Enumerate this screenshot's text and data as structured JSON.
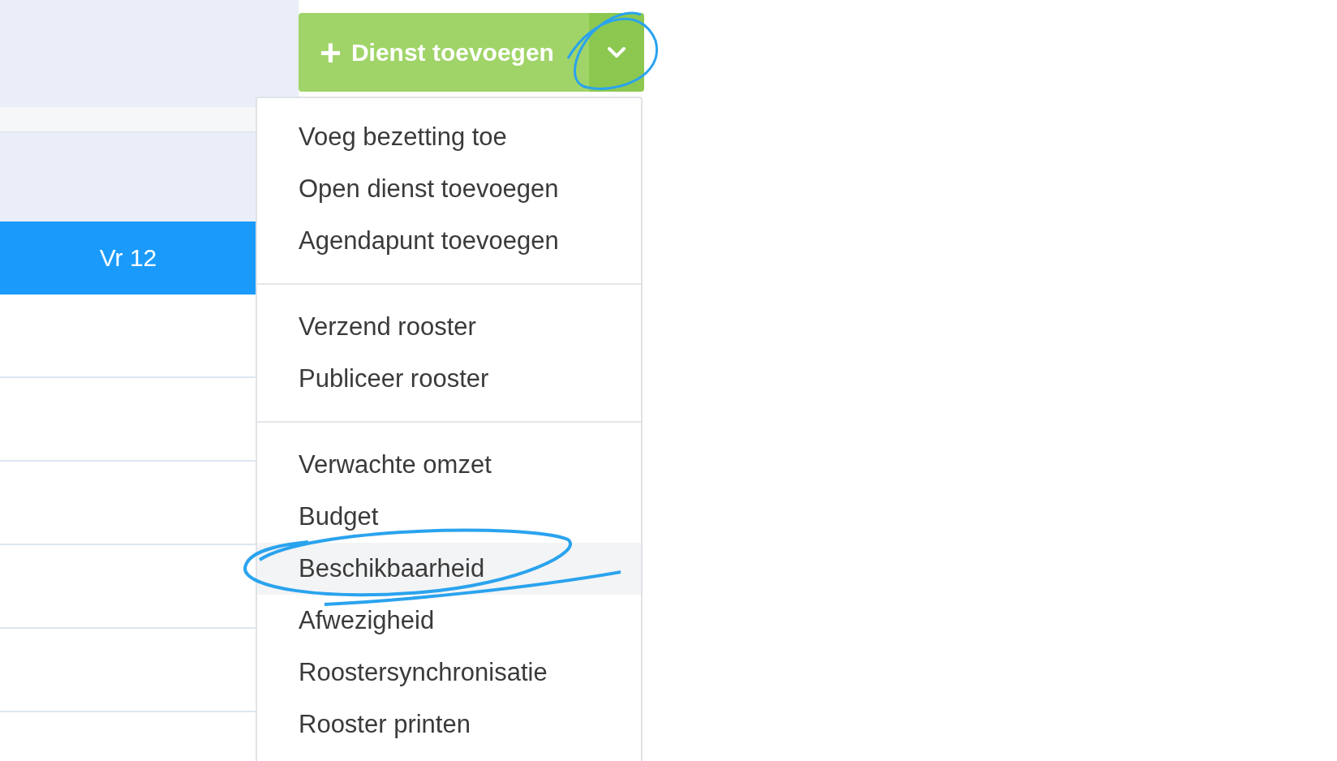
{
  "calendar": {
    "day_header": "Vr 12"
  },
  "add_button": {
    "label": "Dienst toevoegen",
    "icon": "+"
  },
  "menu": {
    "groups": [
      [
        {
          "label": "Voeg bezetting toe",
          "selected": false
        },
        {
          "label": "Open dienst toevoegen",
          "selected": false
        },
        {
          "label": "Agendapunt toevoegen",
          "selected": false
        }
      ],
      [
        {
          "label": "Verzend rooster",
          "selected": false
        },
        {
          "label": "Publiceer rooster",
          "selected": false
        }
      ],
      [
        {
          "label": "Verwachte omzet",
          "selected": false
        },
        {
          "label": "Budget",
          "selected": false
        },
        {
          "label": "Beschikbaarheid",
          "selected": true
        },
        {
          "label": "Afwezigheid",
          "selected": false
        },
        {
          "label": "Roostersynchronisatie",
          "selected": false
        },
        {
          "label": "Rooster printen",
          "selected": false
        }
      ]
    ]
  }
}
